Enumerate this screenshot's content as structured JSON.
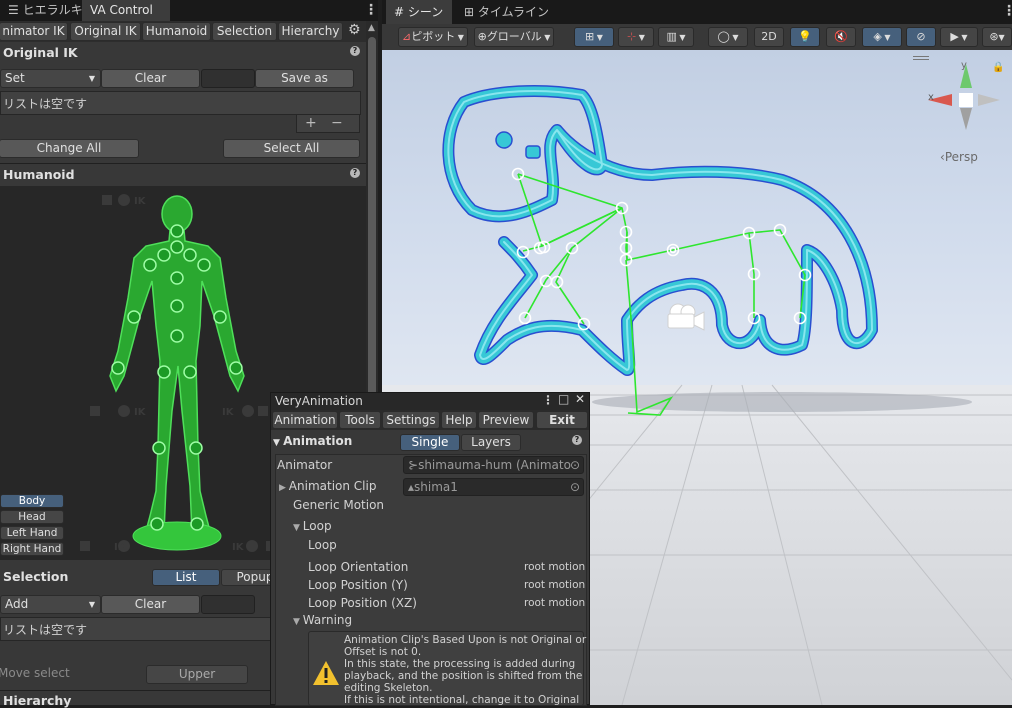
{
  "left_tabs": {
    "hierarchy": "ヒエラルキー",
    "va_control": "VA Control"
  },
  "left_subtabs": [
    "nimator IK",
    "Original IK",
    "Humanoid",
    "Selection",
    "Hierarchy"
  ],
  "original_ik": {
    "title": "Original IK",
    "set": "Set",
    "clear": "Clear",
    "save_as": "Save as",
    "empty": "リストは空です",
    "plus": "+",
    "minus": "−",
    "change_all": "Change All",
    "select_all": "Select All"
  },
  "humanoid": {
    "title": "Humanoid",
    "ik": "IK",
    "body_buttons": [
      "Body",
      "Head",
      "Left Hand",
      "Right Hand"
    ]
  },
  "selection": {
    "title": "Selection",
    "list": "List",
    "popup": "Popup",
    "add": "Add",
    "clear": "Clear",
    "empty": "リストは空です",
    "move_select": "Move select",
    "upper": "Upper"
  },
  "hierarchy_title": "Hierarchy",
  "scene_tabs": {
    "scene": "シーン",
    "timeline": "タイムライン"
  },
  "scene_toolbar": {
    "pivot": "ピボット",
    "global": "グローバル",
    "mode_2d": "2D"
  },
  "gizmo": {
    "y": "y",
    "x": "x",
    "persp": "Persp"
  },
  "va_window": {
    "title": "VeryAnimation",
    "menu": [
      "Animation",
      "Tools",
      "Settings",
      "Help",
      "Preview"
    ],
    "exit": "Exit",
    "section": "Animation",
    "single": "Single",
    "layers": "Layers",
    "animator_label": "Animator",
    "animator_value": "shimauma-hum (Animato",
    "clip_label": "Animation Clip",
    "clip_value": "shima1",
    "generic_motion": "Generic Motion",
    "loop_header": "Loop",
    "loop": "Loop",
    "loop_orientation": "Loop Orientation",
    "loop_position_y": "Loop Position (Y)",
    "loop_position_xz": "Loop Position (XZ)",
    "root_motion": "root motion",
    "warning_header": "Warning",
    "warning_text": [
      "Animation Clip's Based Upon is not Original or",
      "Offset is not 0.",
      "In this state, the processing is added during",
      "playback, and the position is shifted from the",
      "editing Skeleton.",
      "If this is not intentional, change it to Original"
    ]
  },
  "colors": {
    "accent": "#46607c",
    "zebra": "#37c8d6",
    "bones": "#2ee62e",
    "figure": "#3fd84a",
    "sky": "#c9d6ea"
  }
}
